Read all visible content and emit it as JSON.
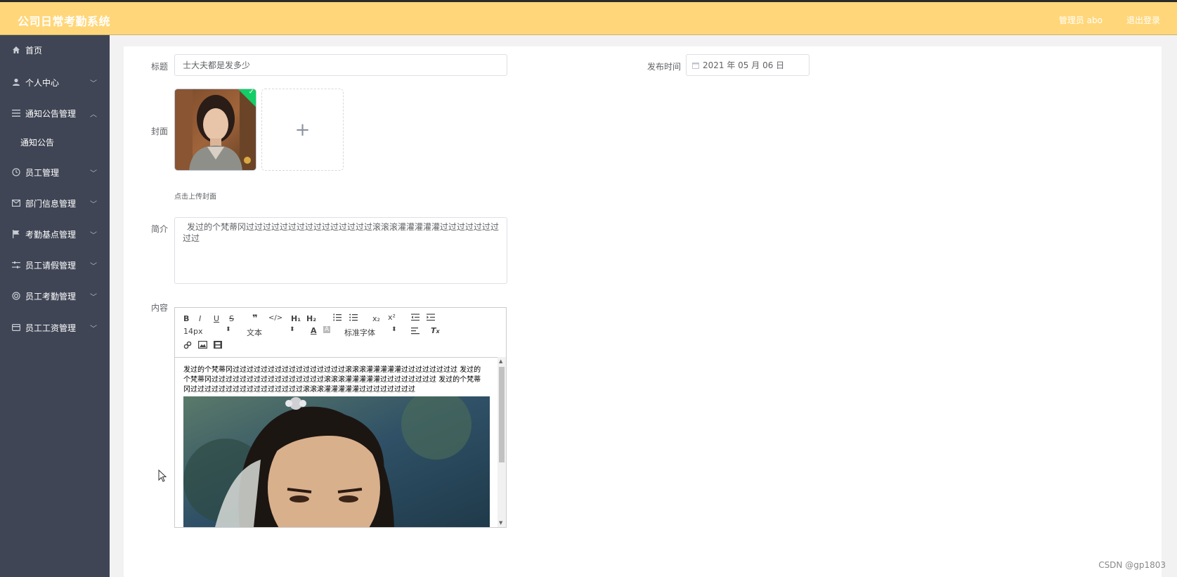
{
  "app": {
    "title": "公司日常考勤系统"
  },
  "header": {
    "user_label": "管理员 abo",
    "logout_label": "退出登录"
  },
  "sidebar": {
    "items": [
      {
        "label": "首页",
        "icon": "home-icon"
      },
      {
        "label": "个人中心",
        "icon": "user-icon"
      },
      {
        "label": "通知公告管理",
        "icon": "menu-icon"
      },
      {
        "label": "员工管理",
        "icon": "clock-icon"
      },
      {
        "label": "部门信息管理",
        "icon": "mail-icon"
      },
      {
        "label": "考勤基点管理",
        "icon": "flag-icon"
      },
      {
        "label": "员工请假管理",
        "icon": "sliders-icon"
      },
      {
        "label": "员工考勤管理",
        "icon": "circle-icon"
      },
      {
        "label": "员工工资管理",
        "icon": "card-icon"
      }
    ],
    "subitem": "通知公告"
  },
  "form": {
    "title_label": "标题",
    "title_value": "士大夫都是发多少",
    "publish_label": "发布时间",
    "publish_value": "2021 年 05 月 06 日",
    "cover_label": "封面",
    "cover_hint": "点击上传封面",
    "summary_label": "简介",
    "summary_value": "发过的个梵蒂冈过过过过过过过过过过过过过过过滚滚滚灌灌灌灌灌过过过过过过过过过",
    "content_label": "内容"
  },
  "editor": {
    "font_size": "14px",
    "block_type": "文本",
    "font_family": "标准字体",
    "content_text": "发过的个梵蒂冈过过过过过过过过过过过过过过过过滚滚滚灌灌灌灌灌过过过过过过过过 发过的个梵蒂冈过过过过过过过过过过过过过过过过滚滚滚灌灌灌灌灌过过过过过过过过 发过的个梵蒂冈过过过过过过过过过过过过过过过过滚滚滚灌灌灌灌灌过过过过过过过过"
  },
  "watermark": "CSDN @gp1803",
  "colors": {
    "header_bg": "#ffd77a",
    "sidebar_bg": "#3f4554",
    "success": "#13ce66"
  }
}
